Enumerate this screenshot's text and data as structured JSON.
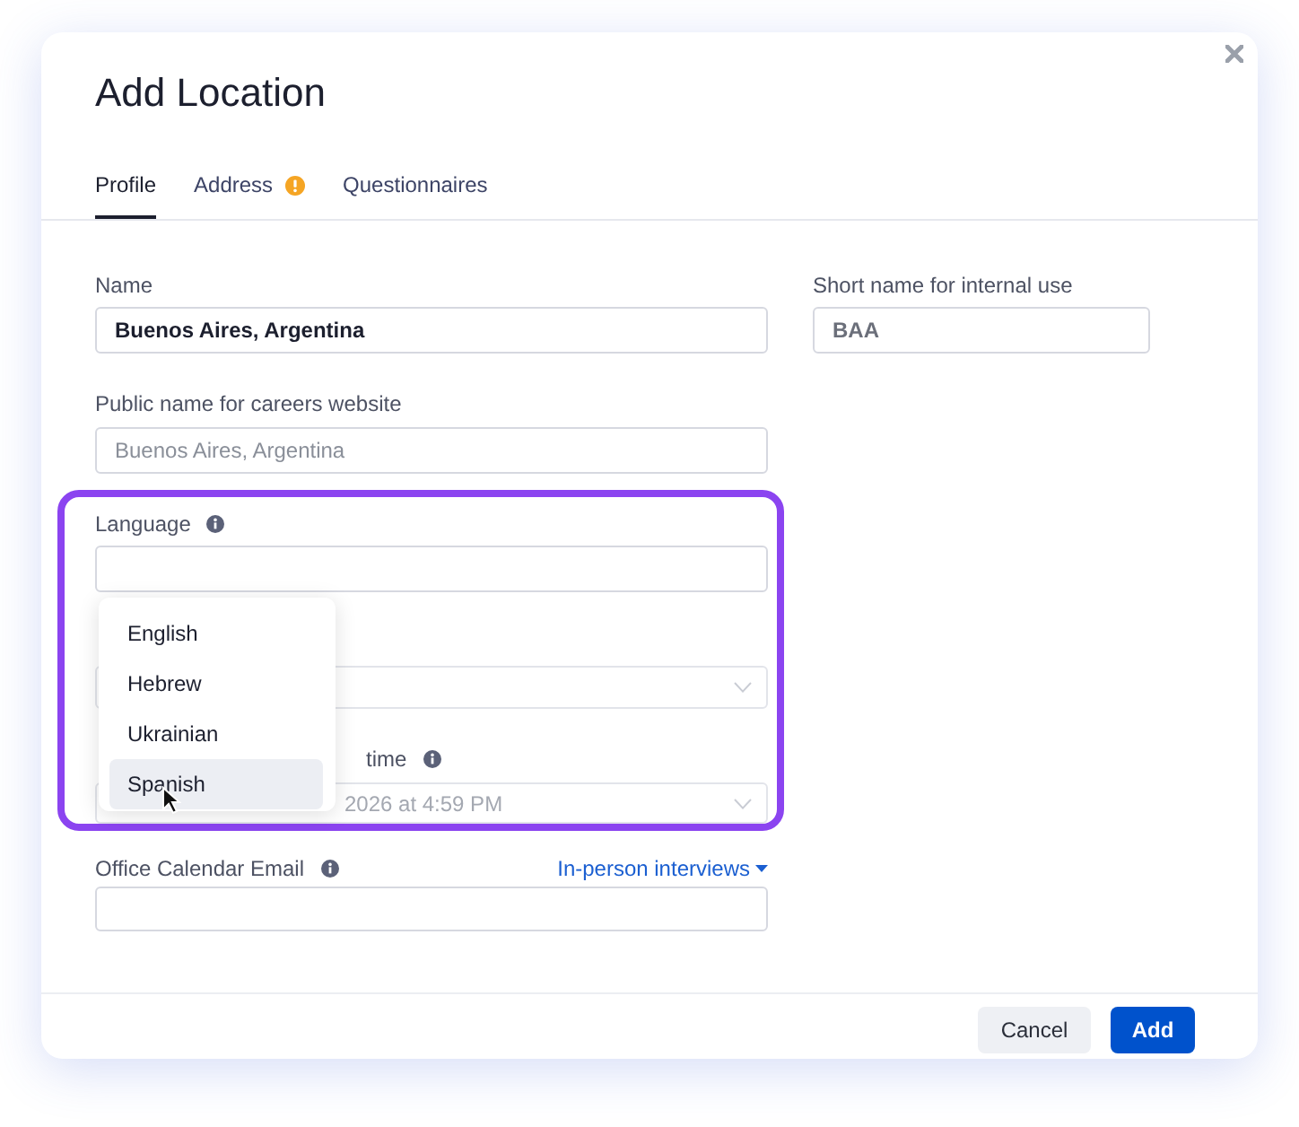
{
  "dialog": {
    "title": "Add Location"
  },
  "tabs": [
    {
      "label": "Profile",
      "selected": true,
      "warning": false
    },
    {
      "label": "Address",
      "selected": false,
      "warning": true
    },
    {
      "label": "Questionnaires",
      "selected": false,
      "warning": false
    }
  ],
  "name_field": {
    "label": "Name",
    "value": "Buenos Aires, Argentina"
  },
  "short_name_field": {
    "label": "Short name for internal use",
    "value": "BAA"
  },
  "public_name_field": {
    "label": "Public name for careers website",
    "placeholder": "Buenos Aires, Argentina"
  },
  "language_field": {
    "label": "Language",
    "info": true,
    "expanded": true,
    "options": [
      {
        "label": "English",
        "selected": false
      },
      {
        "label": "Hebrew",
        "selected": false
      },
      {
        "label": "Ukrainian",
        "selected": false
      },
      {
        "label": "Spanish",
        "selected": true
      }
    ]
  },
  "time_field": {
    "label": "time",
    "info": true,
    "value": "2026 at 4:59 PM"
  },
  "calendar_email_field": {
    "label": "Office Calendar Email",
    "info": true,
    "link": "In-person interviews"
  },
  "buttons": [
    {
      "label": "Cancel",
      "kind": "secondary"
    },
    {
      "label": "Add",
      "kind": "primary"
    }
  ]
}
